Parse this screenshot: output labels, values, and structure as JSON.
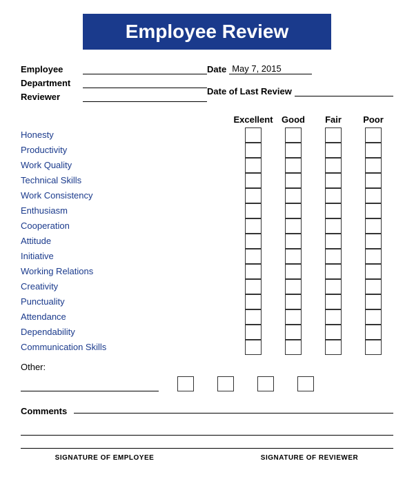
{
  "title": "Employee Review",
  "header": {
    "employee_label": "Employee",
    "department_label": "Department",
    "reviewer_label": "Reviewer",
    "date_label": "Date",
    "date_value": "May 7, 2015",
    "date_last_review_label": "Date of Last Review"
  },
  "ratings": {
    "columns": [
      "Excellent",
      "Good",
      "Fair",
      "Poor"
    ],
    "criteria": [
      "Honesty",
      "Productivity",
      "Work Quality",
      "Technical Skills",
      "Work Consistency",
      "Enthusiasm",
      "Cooperation",
      "Attitude",
      "Initiative",
      "Working Relations",
      "Creativity",
      "Punctuality",
      "Attendance",
      "Dependability",
      "Communication Skills"
    ]
  },
  "other_label": "Other:",
  "comments_label": "Comments",
  "signatures": {
    "employee": "SIGNATURE OF EMPLOYEE",
    "reviewer": "SIGNATURE OF REVIEWER"
  }
}
